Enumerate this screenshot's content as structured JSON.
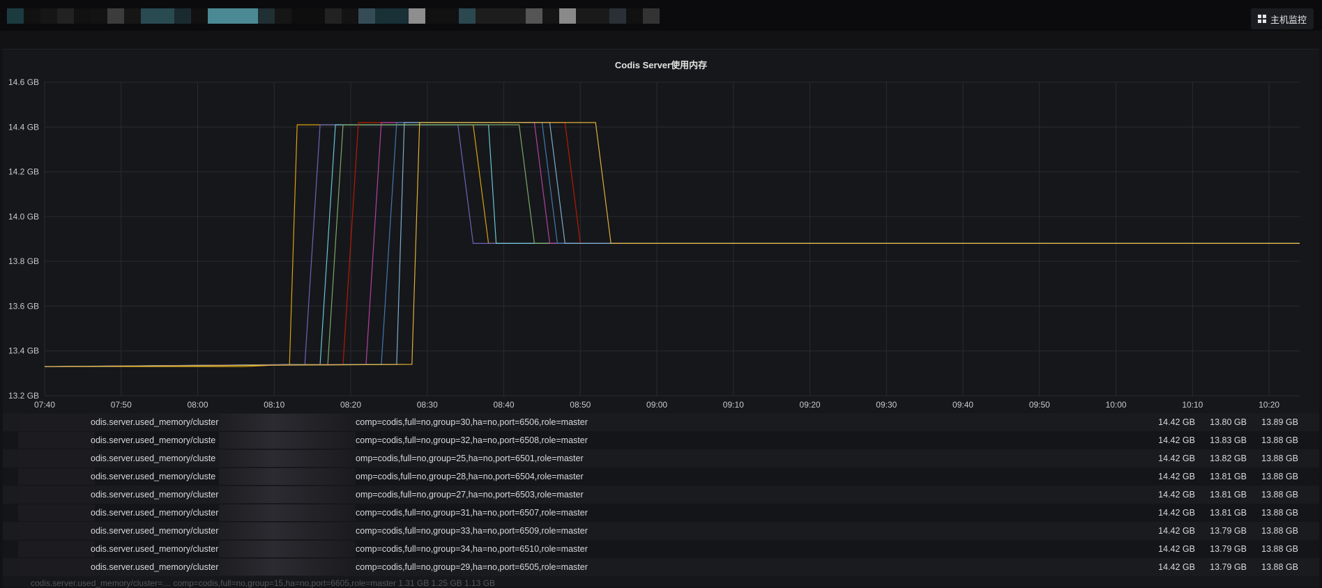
{
  "header": {
    "host_button_label": "主机监控",
    "host_button_icon": "dashboard-grid-icon"
  },
  "panel": {
    "title": "Codis Server使用内存"
  },
  "chart_data": {
    "type": "line",
    "title": "Codis Server使用内存",
    "xlabel": "",
    "ylabel": "",
    "y_unit": "GB",
    "ylim": [
      13.2,
      14.6
    ],
    "y_ticks": [
      "14.6 GB",
      "14.4 GB",
      "14.2 GB",
      "14.0 GB",
      "13.8 GB",
      "13.6 GB",
      "13.4 GB",
      "13.2 GB"
    ],
    "x_ticks": [
      "07:40",
      "07:50",
      "08:00",
      "08:10",
      "08:20",
      "08:30",
      "08:40",
      "08:50",
      "09:00",
      "09:10",
      "09:20",
      "09:30",
      "09:40",
      "09:50",
      "10:00",
      "10:10",
      "10:20"
    ],
    "x_range": [
      "07:40",
      "10:24"
    ],
    "grid": true,
    "legend_position": "bottom",
    "series": [
      {
        "color": "#e5ac0e",
        "points": [
          [
            "07:40",
            13.33
          ],
          [
            "08:06",
            13.33
          ],
          [
            "08:12",
            13.34
          ],
          [
            "08:13",
            14.41
          ],
          [
            "08:36",
            14.41
          ],
          [
            "08:38",
            13.88
          ],
          [
            "10:24",
            13.88
          ]
        ]
      },
      {
        "color": "#6d6ac5",
        "points": [
          [
            "07:40",
            13.33
          ],
          [
            "08:14",
            13.34
          ],
          [
            "08:16",
            14.41
          ],
          [
            "08:34",
            14.41
          ],
          [
            "08:36",
            13.88
          ],
          [
            "10:24",
            13.88
          ]
        ]
      },
      {
        "color": "#6ed0e0",
        "points": [
          [
            "07:40",
            13.33
          ],
          [
            "08:16",
            13.34
          ],
          [
            "08:18",
            14.41
          ],
          [
            "08:38",
            14.41
          ],
          [
            "08:39",
            13.88
          ],
          [
            "10:24",
            13.88
          ]
        ]
      },
      {
        "color": "#7eb26d",
        "points": [
          [
            "07:40",
            13.33
          ],
          [
            "08:17",
            13.34
          ],
          [
            "08:19",
            14.41
          ],
          [
            "08:42",
            14.41
          ],
          [
            "08:44",
            13.88
          ],
          [
            "10:24",
            13.88
          ]
        ]
      },
      {
        "color": "#bf1b00",
        "points": [
          [
            "07:40",
            13.33
          ],
          [
            "08:19",
            13.34
          ],
          [
            "08:21",
            14.42
          ],
          [
            "08:48",
            14.42
          ],
          [
            "08:50",
            13.88
          ],
          [
            "10:24",
            13.88
          ]
        ]
      },
      {
        "color": "#ba43a9",
        "points": [
          [
            "07:40",
            13.33
          ],
          [
            "08:22",
            13.34
          ],
          [
            "08:24",
            14.42
          ],
          [
            "08:44",
            14.42
          ],
          [
            "08:46",
            13.88
          ],
          [
            "10:24",
            13.88
          ]
        ]
      },
      {
        "color": "#447ebc",
        "points": [
          [
            "07:40",
            13.33
          ],
          [
            "08:24",
            13.34
          ],
          [
            "08:26",
            14.42
          ],
          [
            "08:45",
            14.42
          ],
          [
            "08:47",
            13.88
          ],
          [
            "10:24",
            13.88
          ]
        ]
      },
      {
        "color": "#82b5d8",
        "points": [
          [
            "07:40",
            13.33
          ],
          [
            "08:26",
            13.34
          ],
          [
            "08:27",
            14.42
          ],
          [
            "08:46",
            14.42
          ],
          [
            "08:48",
            13.88
          ],
          [
            "10:24",
            13.88
          ]
        ]
      },
      {
        "color": "#eab839",
        "points": [
          [
            "07:40",
            13.33
          ],
          [
            "08:28",
            13.34
          ],
          [
            "08:29",
            14.42
          ],
          [
            "08:52",
            14.42
          ],
          [
            "08:54",
            13.88
          ],
          [
            "10:24",
            13.88
          ]
        ]
      }
    ]
  },
  "legend": {
    "rows": [
      {
        "name": "odis.server.used_memory/cluster",
        "tags": "comp=codis,full=no,group=30,ha=no,port=6506,role=master",
        "max": "14.42 GB",
        "min": "13.80 GB",
        "current": "13.89 GB"
      },
      {
        "name": "odis.server.used_memory/cluste",
        "tags": "comp=codis,full=no,group=32,ha=no,port=6508,role=master",
        "max": "14.42 GB",
        "min": "13.83 GB",
        "current": "13.88 GB"
      },
      {
        "name": "odis.server.used_memory/cluste",
        "tags": "omp=codis,full=no,group=25,ha=no,port=6501,role=master",
        "max": "14.42 GB",
        "min": "13.82 GB",
        "current": "13.88 GB"
      },
      {
        "name": "odis.server.used_memory/cluste",
        "tags": "omp=codis,full=no,group=28,ha=no,port=6504,role=master",
        "max": "14.42 GB",
        "min": "13.81 GB",
        "current": "13.88 GB"
      },
      {
        "name": "odis.server.used_memory/cluster=",
        "tags": "omp=codis,full=no,group=27,ha=no,port=6503,role=master",
        "max": "14.42 GB",
        "min": "13.81 GB",
        "current": "13.88 GB"
      },
      {
        "name": "odis.server.used_memory/cluster=",
        "tags": "comp=codis,full=no,group=31,ha=no,port=6507,role=master",
        "max": "14.42 GB",
        "min": "13.81 GB",
        "current": "13.88 GB"
      },
      {
        "name": "odis.server.used_memory/cluster=",
        "tags": "comp=codis,full=no,group=33,ha=no,port=6509,role=master",
        "max": "14.42 GB",
        "min": "13.79 GB",
        "current": "13.88 GB"
      },
      {
        "name": "odis.server.used_memory/cluster",
        "tags": "comp=codis,full=no,group=34,ha=no,port=6510,role=master",
        "max": "14.42 GB",
        "min": "13.79 GB",
        "current": "13.88 GB"
      },
      {
        "name": "odis.server.used_memory/cluster",
        "tags": "comp=codis,full=no,group=29,ha=no,port=6505,role=master",
        "max": "14.42 GB",
        "min": "13.79 GB",
        "current": "13.88 GB"
      }
    ],
    "cutoff_row": "codis.server.used_memory/cluster=… comp=codis,full=no,group=15,ha=no,port=6605,role=master   1.31 GB   1.25 GB   1.13 GB"
  }
}
